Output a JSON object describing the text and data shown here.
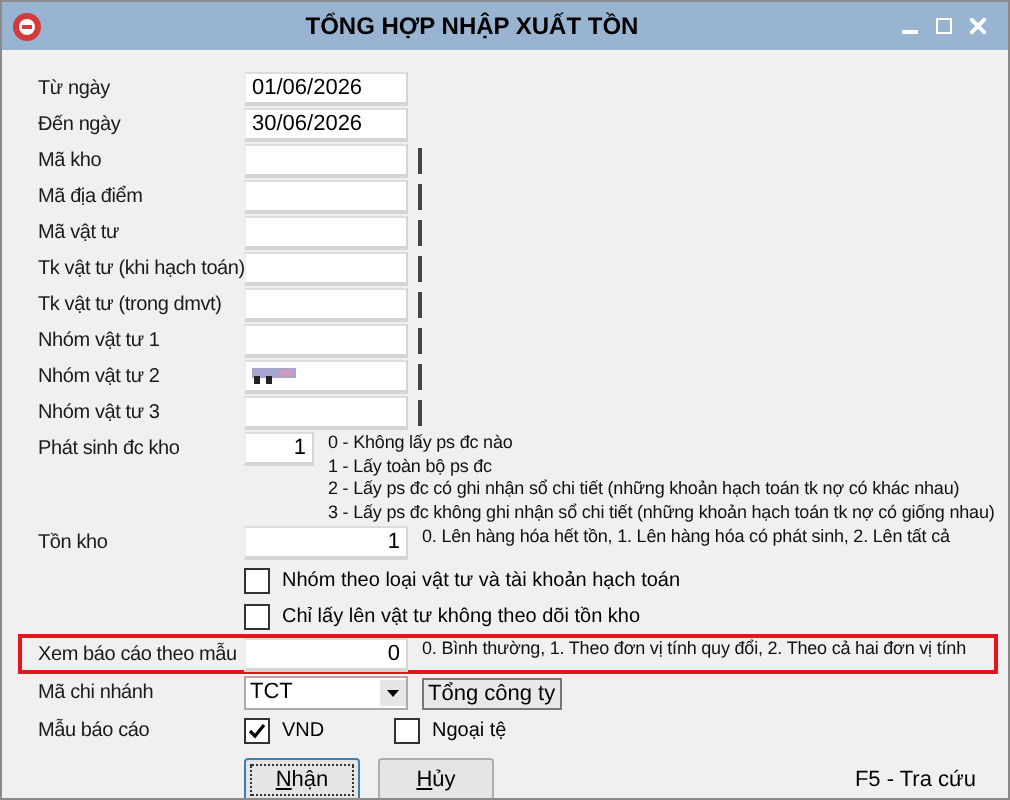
{
  "window": {
    "title": "TỔNG HỢP NHẬP XUẤT TỒN"
  },
  "rows": [
    {
      "kind": "date",
      "label": "Từ ngày",
      "value": "01/06/2026"
    },
    {
      "kind": "date",
      "label": "Đến ngày",
      "value": "30/06/2026"
    },
    {
      "kind": "lookup",
      "label": "Mã kho"
    },
    {
      "kind": "lookup",
      "label": "Mã địa điểm"
    },
    {
      "kind": "lookup",
      "label": "Mã vật tư"
    },
    {
      "kind": "lookup",
      "label": "Tk vật tư (khi hạch toán)"
    },
    {
      "kind": "lookup",
      "label": "Tk vật tư (trong dmvt)"
    },
    {
      "kind": "lookup",
      "label": "Nhóm vật tư 1"
    },
    {
      "kind": "lookup",
      "label": "Nhóm vật tư 2",
      "blurred": true
    },
    {
      "kind": "lookup",
      "label": "Nhóm vật tư 3"
    },
    {
      "kind": "short-number",
      "label": "Phát sinh đc kho",
      "value": "1",
      "highlighted": false,
      "notes": [
        "0 - Không lấy ps đc nào",
        "1 - Lấy toàn bộ ps đc",
        "2 - Lấy ps đc có ghi nhận sổ chi tiết (những khoản hạch toán tk nợ có khác nhau)",
        "3 - Lấy ps đc không ghi nhận sổ chi tiết (những khoản hạch toán tk nợ có giống nhau)"
      ]
    },
    {
      "kind": "number",
      "label": "Tồn kho",
      "value": "1",
      "highlighted": false,
      "notes": [
        "0. Lên hàng hóa hết tồn, 1. Lên hàng hóa có phát sinh, 2. Lên tất cả"
      ]
    },
    {
      "kind": "checkbox",
      "label": "Nhóm theo loại vật tư và tài khoản hạch toán",
      "checked": false
    },
    {
      "kind": "checkbox",
      "label": "Chỉ lấy lên vật tư không theo dõi tồn kho",
      "checked": false
    },
    {
      "kind": "number",
      "label": "Xem báo cáo theo mẫu",
      "value": "0",
      "highlighted": true,
      "notes": [
        "0. Bình thường, 1. Theo đơn vị tính quy đổi, 2. Theo cả hai đơn vị tính"
      ]
    },
    {
      "kind": "dropdown",
      "label": "Mã chi nhánh",
      "value": "TCT",
      "caption": "Tổng công ty"
    },
    {
      "kind": "checkgroup",
      "label": "Mẫu báo cáo",
      "options": [
        {
          "label": "VND",
          "checked": true
        },
        {
          "label": "Ngoại tệ",
          "checked": false
        }
      ]
    }
  ],
  "buttons": [
    {
      "label": "Nhận",
      "focused": true
    },
    {
      "label": "Hủy",
      "focused": false
    }
  ],
  "hint": "F5 - Tra cứu"
}
